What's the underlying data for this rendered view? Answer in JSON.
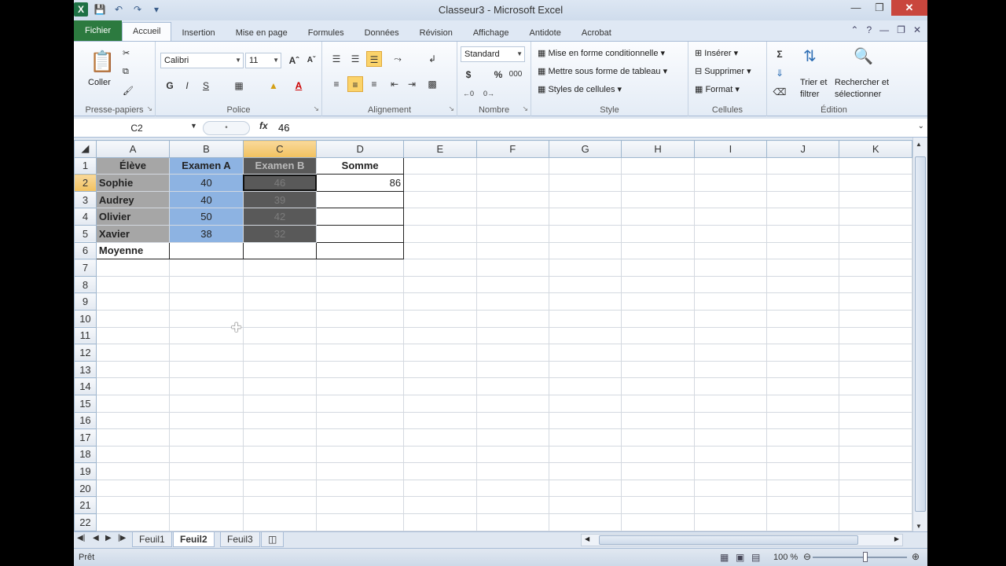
{
  "window": {
    "title": "Classeur3 - Microsoft Excel"
  },
  "tabs": [
    "Fichier",
    "Accueil",
    "Insertion",
    "Mise en page",
    "Formules",
    "Données",
    "Révision",
    "Affichage",
    "Antidote",
    "Acrobat"
  ],
  "ribbon": {
    "clipboard": {
      "paste": "Coller",
      "label": "Presse-papiers"
    },
    "font": {
      "name": "Calibri",
      "size": "11",
      "bold": "G",
      "italic": "I",
      "underline": "S",
      "label": "Police"
    },
    "alignment": {
      "label": "Alignement"
    },
    "number": {
      "format": "Standard",
      "currency": "$",
      "percent": "%",
      "thousands": "000",
      "label": "Nombre"
    },
    "style": {
      "conditional": "Mise en forme conditionnelle",
      "table": "Mettre sous forme de tableau",
      "cellstyles": "Styles de cellules",
      "label": "Style"
    },
    "cells": {
      "insert": "Insérer",
      "delete": "Supprimer",
      "format": "Format",
      "label": "Cellules"
    },
    "editing": {
      "sort1": "Trier et",
      "sort2": "filtrer",
      "find1": "Rechercher et",
      "find2": "sélectionner",
      "label": "Édition"
    }
  },
  "formula_bar": {
    "namebox": "C2",
    "fx": "fx",
    "value": "46"
  },
  "sheet": {
    "columns": [
      "A",
      "B",
      "C",
      "D",
      "E",
      "F",
      "G",
      "H",
      "I",
      "J",
      "K"
    ],
    "rows": [
      [
        "Élève",
        "Examen A",
        "Examen B",
        "Somme"
      ],
      [
        "Sophie",
        "40",
        "46",
        "86"
      ],
      [
        "Audrey",
        "40",
        "39",
        ""
      ],
      [
        "Olivier",
        "50",
        "42",
        ""
      ],
      [
        "Xavier",
        "38",
        "32",
        ""
      ],
      [
        "Moyenne",
        "",
        "",
        ""
      ]
    ],
    "row_numbers": [
      "1",
      "2",
      "3",
      "4",
      "5",
      "6",
      "7",
      "8",
      "9",
      "10",
      "11",
      "12",
      "13",
      "14",
      "15",
      "16",
      "17",
      "18",
      "19",
      "20",
      "21",
      "22"
    ]
  },
  "sheet_tabs": [
    "Feuil1",
    "Feuil2",
    "Feuil3"
  ],
  "status": {
    "ready": "Prêt",
    "zoom": "100 %"
  }
}
